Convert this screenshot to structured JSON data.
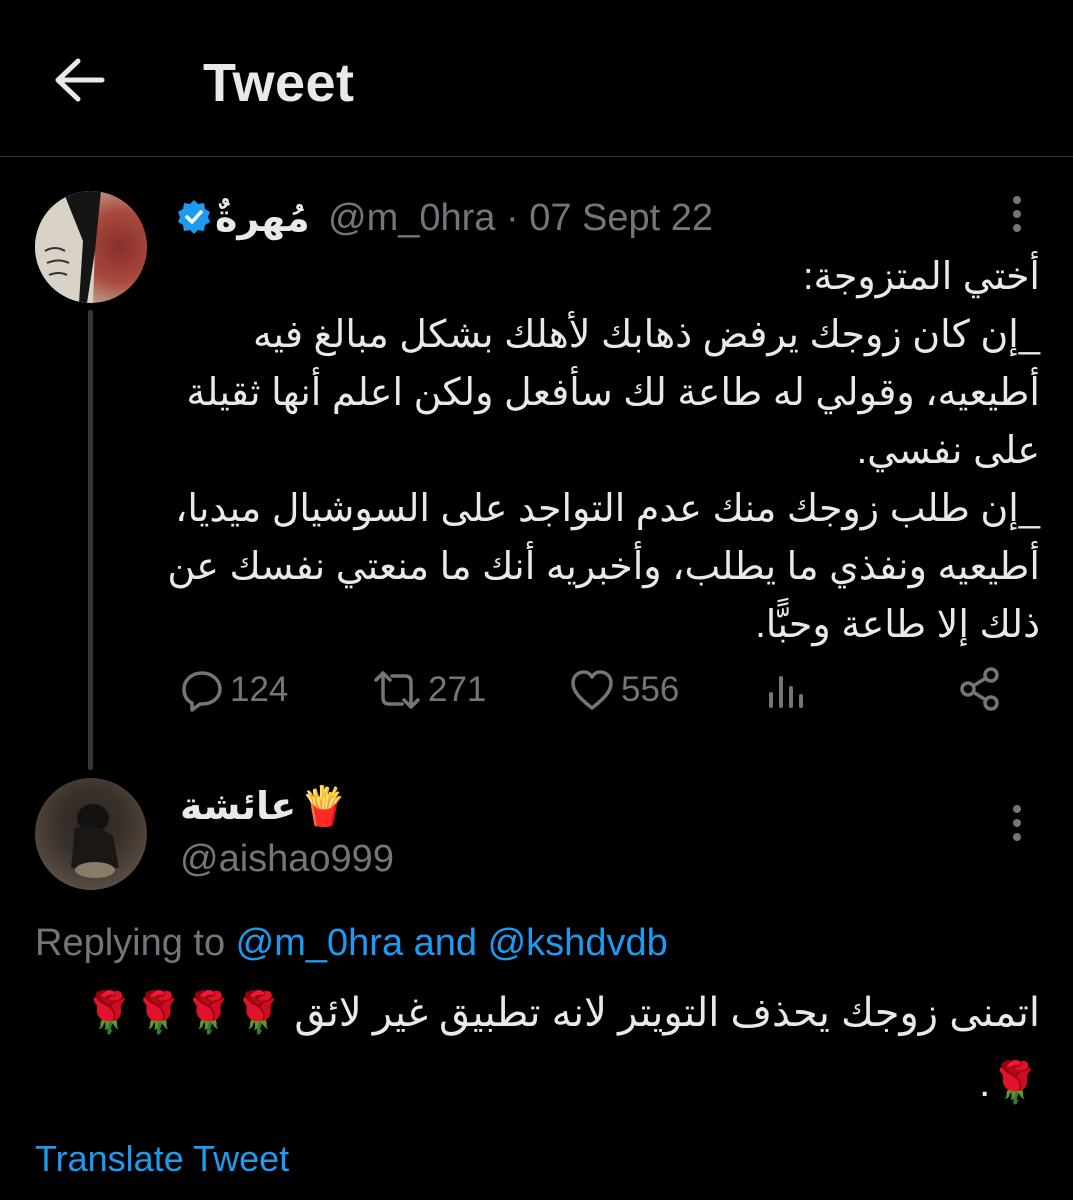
{
  "header": {
    "title": "Tweet"
  },
  "tweet": {
    "author_name": "مُهرةٌ",
    "handle_date": "@m_0hra · 07 Sept 22",
    "body": "أختي المتزوجة:\n_إن كان زوجك يرفض ذهابك لأهلك بشكل مبالغ فيه أطيعيه، وقولي له طاعة لك سأفعل ولكن اعلم أنها ثقيلة على نفسي.\n_إن طلب زوجك منك عدم التواجد على السوشيال ميديا، أطيعيه ونفذي ما يطلب، وأخبريه أنك ما منعتي نفسك عن ذلك إلا طاعة وحبًّا.",
    "stats": {
      "replies": "124",
      "retweets": "271",
      "likes": "556"
    }
  },
  "reply": {
    "author_name": "عائشة",
    "author_emoji": "🍟",
    "handle": "@aishao999",
    "replying_prefix": "Replying to ",
    "replying_users": "@m_0hra and @kshdvdb",
    "body": "اتمنى زوجك يحذف التويتر لانه تطبيق غير لائق 🌹🌹🌹🌹🌹.",
    "translate_label": "Translate Tweet"
  },
  "colors": {
    "accent": "#1d9bf0",
    "muted": "#71767b",
    "text": "#e7e9ea",
    "background": "#000000"
  }
}
